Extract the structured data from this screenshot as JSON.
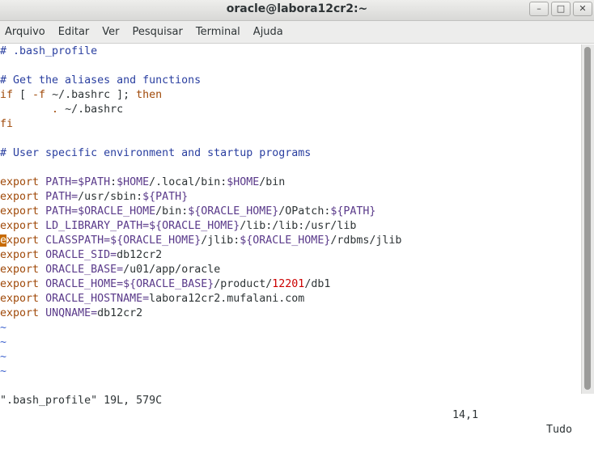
{
  "window": {
    "title": "oracle@labora12cr2:~"
  },
  "window_buttons": {
    "minimize": "–",
    "maximize": "□",
    "close": "✕"
  },
  "menu": {
    "items": [
      "Arquivo",
      "Editar",
      "Ver",
      "Pesquisar",
      "Terminal",
      "Ajuda"
    ]
  },
  "editor": {
    "lines": [
      [
        {
          "t": "# .bash_profile",
          "c": "cm"
        }
      ],
      [],
      [
        {
          "t": "# Get the aliases and functions",
          "c": "cm"
        }
      ],
      [
        {
          "t": "if",
          "c": "kw"
        },
        {
          "t": " [ ",
          "c": ""
        },
        {
          "t": "-f",
          "c": "kw"
        },
        {
          "t": " ~/.bashrc ]; ",
          "c": ""
        },
        {
          "t": "then",
          "c": "kw"
        }
      ],
      [
        {
          "t": "        ",
          "c": ""
        },
        {
          "t": ".",
          "c": "kw"
        },
        {
          "t": " ~/.bashrc",
          "c": ""
        }
      ],
      [
        {
          "t": "fi",
          "c": "kw"
        }
      ],
      [],
      [
        {
          "t": "# User specific environment and startup programs",
          "c": "cm"
        }
      ],
      [],
      [
        {
          "t": "export",
          "c": "kw"
        },
        {
          "t": " ",
          "c": ""
        },
        {
          "t": "PATH=",
          "c": "var"
        },
        {
          "t": "$PATH",
          "c": "var"
        },
        {
          "t": ":",
          "c": ""
        },
        {
          "t": "$HOME",
          "c": "var"
        },
        {
          "t": "/.local/bin:",
          "c": ""
        },
        {
          "t": "$HOME",
          "c": "var"
        },
        {
          "t": "/bin",
          "c": ""
        }
      ],
      [
        {
          "t": "export",
          "c": "kw"
        },
        {
          "t": " ",
          "c": ""
        },
        {
          "t": "PATH=",
          "c": "var"
        },
        {
          "t": "/usr/sbin:",
          "c": ""
        },
        {
          "t": "${PATH}",
          "c": "var"
        }
      ],
      [
        {
          "t": "export",
          "c": "kw"
        },
        {
          "t": " ",
          "c": ""
        },
        {
          "t": "PATH=",
          "c": "var"
        },
        {
          "t": "$ORACLE_HOME",
          "c": "var"
        },
        {
          "t": "/bin:",
          "c": ""
        },
        {
          "t": "${ORACLE_HOME}",
          "c": "var"
        },
        {
          "t": "/OPatch:",
          "c": ""
        },
        {
          "t": "${PATH}",
          "c": "var"
        }
      ],
      [
        {
          "t": "export",
          "c": "kw"
        },
        {
          "t": " ",
          "c": ""
        },
        {
          "t": "LD_LIBRARY_PATH=",
          "c": "var"
        },
        {
          "t": "${ORACLE_HOME}",
          "c": "var"
        },
        {
          "t": "/lib:/lib:/usr/lib",
          "c": ""
        }
      ],
      [
        {
          "t": "e",
          "c": "kw cursor"
        },
        {
          "t": "xport",
          "c": "kw"
        },
        {
          "t": " ",
          "c": ""
        },
        {
          "t": "CLASSPATH=",
          "c": "var"
        },
        {
          "t": "${ORACLE_HOME}",
          "c": "var"
        },
        {
          "t": "/jlib:",
          "c": ""
        },
        {
          "t": "${ORACLE_HOME}",
          "c": "var"
        },
        {
          "t": "/rdbms/jlib",
          "c": ""
        }
      ],
      [
        {
          "t": "export",
          "c": "kw"
        },
        {
          "t": " ",
          "c": ""
        },
        {
          "t": "ORACLE_SID=",
          "c": "var"
        },
        {
          "t": "db12cr2",
          "c": ""
        }
      ],
      [
        {
          "t": "export",
          "c": "kw"
        },
        {
          "t": " ",
          "c": ""
        },
        {
          "t": "ORACLE_BASE=",
          "c": "var"
        },
        {
          "t": "/u01/app/oracle",
          "c": ""
        }
      ],
      [
        {
          "t": "export",
          "c": "kw"
        },
        {
          "t": " ",
          "c": ""
        },
        {
          "t": "ORACLE_HOME=",
          "c": "var"
        },
        {
          "t": "${ORACLE_BASE}",
          "c": "var"
        },
        {
          "t": "/product/",
          "c": ""
        },
        {
          "t": "12201",
          "c": "num"
        },
        {
          "t": "/db1",
          "c": ""
        }
      ],
      [
        {
          "t": "export",
          "c": "kw"
        },
        {
          "t": " ",
          "c": ""
        },
        {
          "t": "ORACLE_HOSTNAME=",
          "c": "var"
        },
        {
          "t": "labora12cr2.mufalani.com",
          "c": ""
        }
      ],
      [
        {
          "t": "export",
          "c": "kw"
        },
        {
          "t": " ",
          "c": ""
        },
        {
          "t": "UNQNAME=",
          "c": "var"
        },
        {
          "t": "db12cr2",
          "c": ""
        }
      ],
      [
        {
          "t": "~",
          "c": "tilde"
        }
      ],
      [
        {
          "t": "~",
          "c": "tilde"
        }
      ],
      [
        {
          "t": "~",
          "c": "tilde"
        }
      ],
      [
        {
          "t": "~",
          "c": "tilde"
        }
      ]
    ]
  },
  "status": {
    "file": "\".bash_profile\" 19L, 579C",
    "position": "14,1",
    "scroll": "Tudo"
  },
  "colors": {
    "keyword": "#a04a0a",
    "comment": "#2a3fa0",
    "variable": "#5a3a8a",
    "number": "#cc0000",
    "cursor": "#c76a00"
  }
}
